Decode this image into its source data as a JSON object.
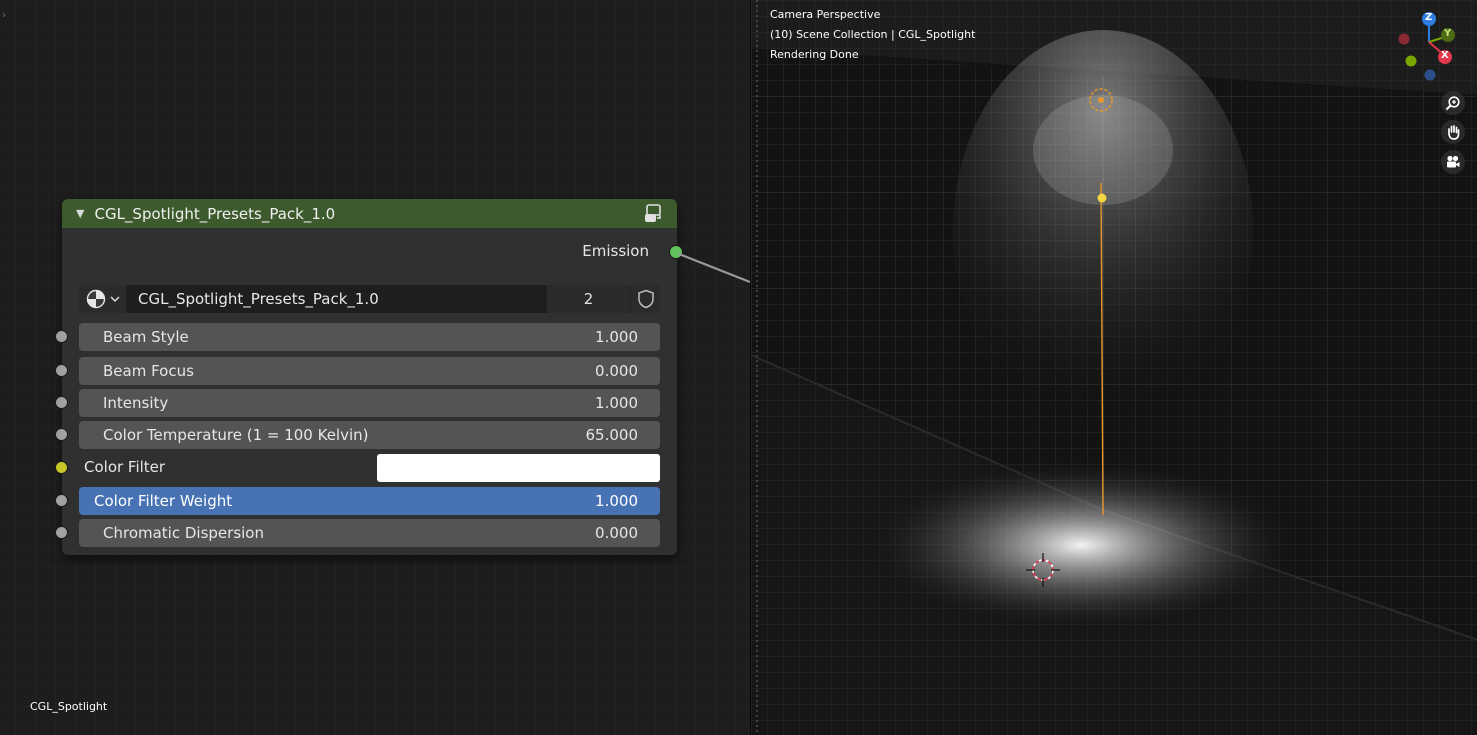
{
  "node_editor": {
    "editor_label": "CGL_Spotlight",
    "node": {
      "title": "CGL_Spotlight_Presets_Pack_1.0",
      "output_label": "Emission",
      "datablock": {
        "name": "CGL_Spotlight_Presets_Pack_1.0",
        "users": "2"
      },
      "inputs": [
        {
          "label": "Beam Style",
          "value": "1.000"
        },
        {
          "label": "Beam Focus",
          "value": "0.000"
        },
        {
          "label": "Intensity",
          "value": "1.000"
        },
        {
          "label": "Color Temperature (1 = 100 Kelvin)",
          "value": "65.000"
        },
        {
          "label": "Color Filter",
          "color": "#ffffff"
        },
        {
          "label": "Color Filter Weight",
          "value": "1.000"
        },
        {
          "label": "Chromatic Dispersion",
          "value": "0.000"
        }
      ]
    }
  },
  "viewport": {
    "mode": "Camera Perspective",
    "collection": "(10) Scene Collection | CGL_Spotlight",
    "status": "Rendering Done",
    "gizmo": {
      "z": "Z",
      "y": "Y",
      "x": "X"
    }
  },
  "colors": {
    "header_green": "#3c5a2b",
    "active_field": "#4772b3",
    "socket_green": "#62c25e",
    "socket_yellow": "#c7c729",
    "axis_x": "#e2384b",
    "axis_y": "#7aa600",
    "axis_z": "#2e7de2",
    "light_yellow": "#f5d442",
    "light_line": "#e8962c"
  }
}
